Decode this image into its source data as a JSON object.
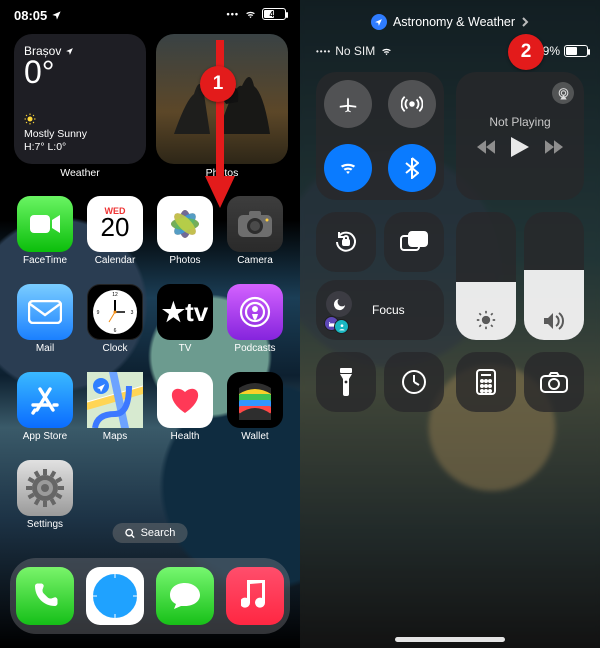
{
  "left": {
    "status": {
      "time": "08:05",
      "battery": "49"
    },
    "weather": {
      "location": "Brașov",
      "temp": "0°",
      "desc": "Mostly Sunny",
      "hilo": "H:7° L:0°",
      "label": "Weather"
    },
    "photos_label": "Photos",
    "calendar": {
      "day": "WED",
      "num": "20"
    },
    "apps": {
      "facetime": "FaceTime",
      "calendar": "Calendar",
      "photos": "Photos",
      "camera": "Camera",
      "mail": "Mail",
      "clock": "Clock",
      "tv": "TV",
      "podcasts": "Podcasts",
      "appstore": "App Store",
      "maps": "Maps",
      "health": "Health",
      "wallet": "Wallet",
      "settings": "Settings"
    },
    "tv_text": "★tv",
    "search": "Search",
    "callout": "1"
  },
  "right": {
    "return_app": "Astronomy & Weather",
    "status": {
      "carrier": "No SIM",
      "battery": "49%"
    },
    "media": {
      "np": "Not Playing"
    },
    "focus": "Focus",
    "callout": "2"
  }
}
